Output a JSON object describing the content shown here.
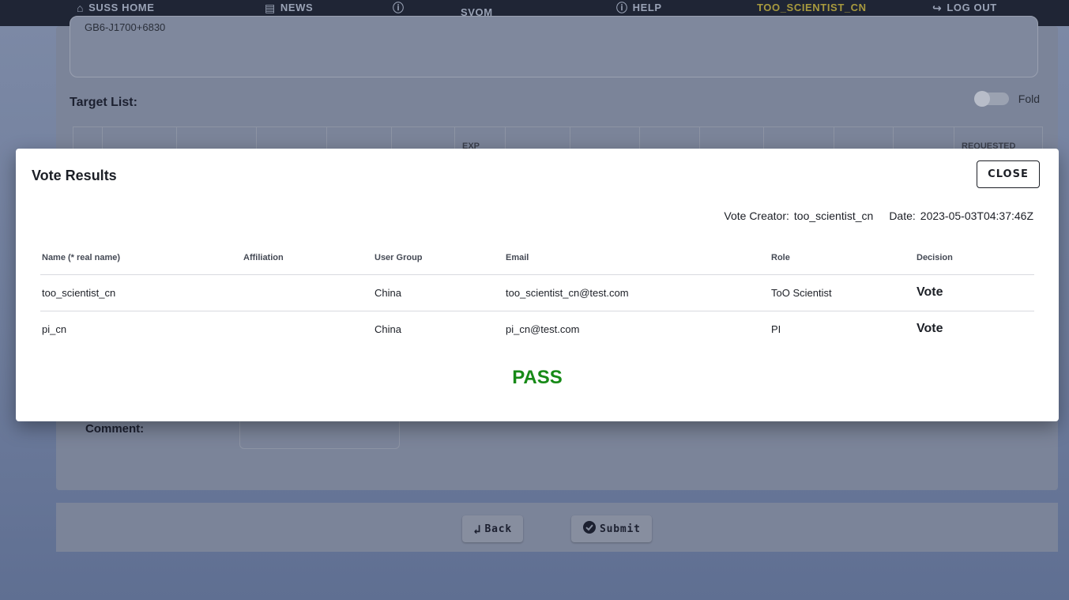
{
  "nav": {
    "items": [
      {
        "label": "SUSS HOME",
        "icon": "home-icon",
        "glyph": "⌂"
      },
      {
        "label": "NEWS",
        "icon": "news-icon",
        "glyph": "▤"
      },
      {
        "label": "",
        "icon": "help-circle-icon",
        "glyph": "ⓘ"
      },
      {
        "label": "SVOM",
        "icon": "",
        "glyph": ""
      },
      {
        "label": "HELP",
        "icon": "help-circle-icon",
        "glyph": "ⓘ"
      },
      {
        "label": "TOO_SCIENTIST_CN",
        "icon": "",
        "glyph": ""
      },
      {
        "label": "LOG OUT",
        "icon": "logout-icon",
        "glyph": "↪"
      }
    ]
  },
  "background": {
    "textarea_value": "GB6-J1700+6830",
    "target_list_label": "Target List:",
    "fold_label": "Fold",
    "grid_headers": [
      "EXP",
      "REQUESTED"
    ],
    "comment_label": "Comment:",
    "back_label": "Back",
    "submit_label": "Submit"
  },
  "modal": {
    "title": "Vote Results",
    "close_label": "CLOSE",
    "creator_key": "Vote Creator:",
    "creator_value": "too_scientist_cn",
    "date_key": "Date:",
    "date_value": "2023-05-03T04:37:46Z",
    "columns": [
      "Name (* real name)",
      "Affiliation",
      "User Group",
      "Email",
      "Role",
      "Decision"
    ],
    "rows": [
      {
        "name": "too_scientist_cn",
        "affiliation": "",
        "group": "China",
        "email": "too_scientist_cn@test.com",
        "role": "ToO Scientist",
        "decision": "Vote"
      },
      {
        "name": "pi_cn",
        "affiliation": "",
        "group": "China",
        "email": "pi_cn@test.com",
        "role": "PI",
        "decision": "Vote"
      }
    ],
    "result": "PASS"
  },
  "colors": {
    "pass": "#178a17",
    "nav_active": "#a89a3e"
  }
}
